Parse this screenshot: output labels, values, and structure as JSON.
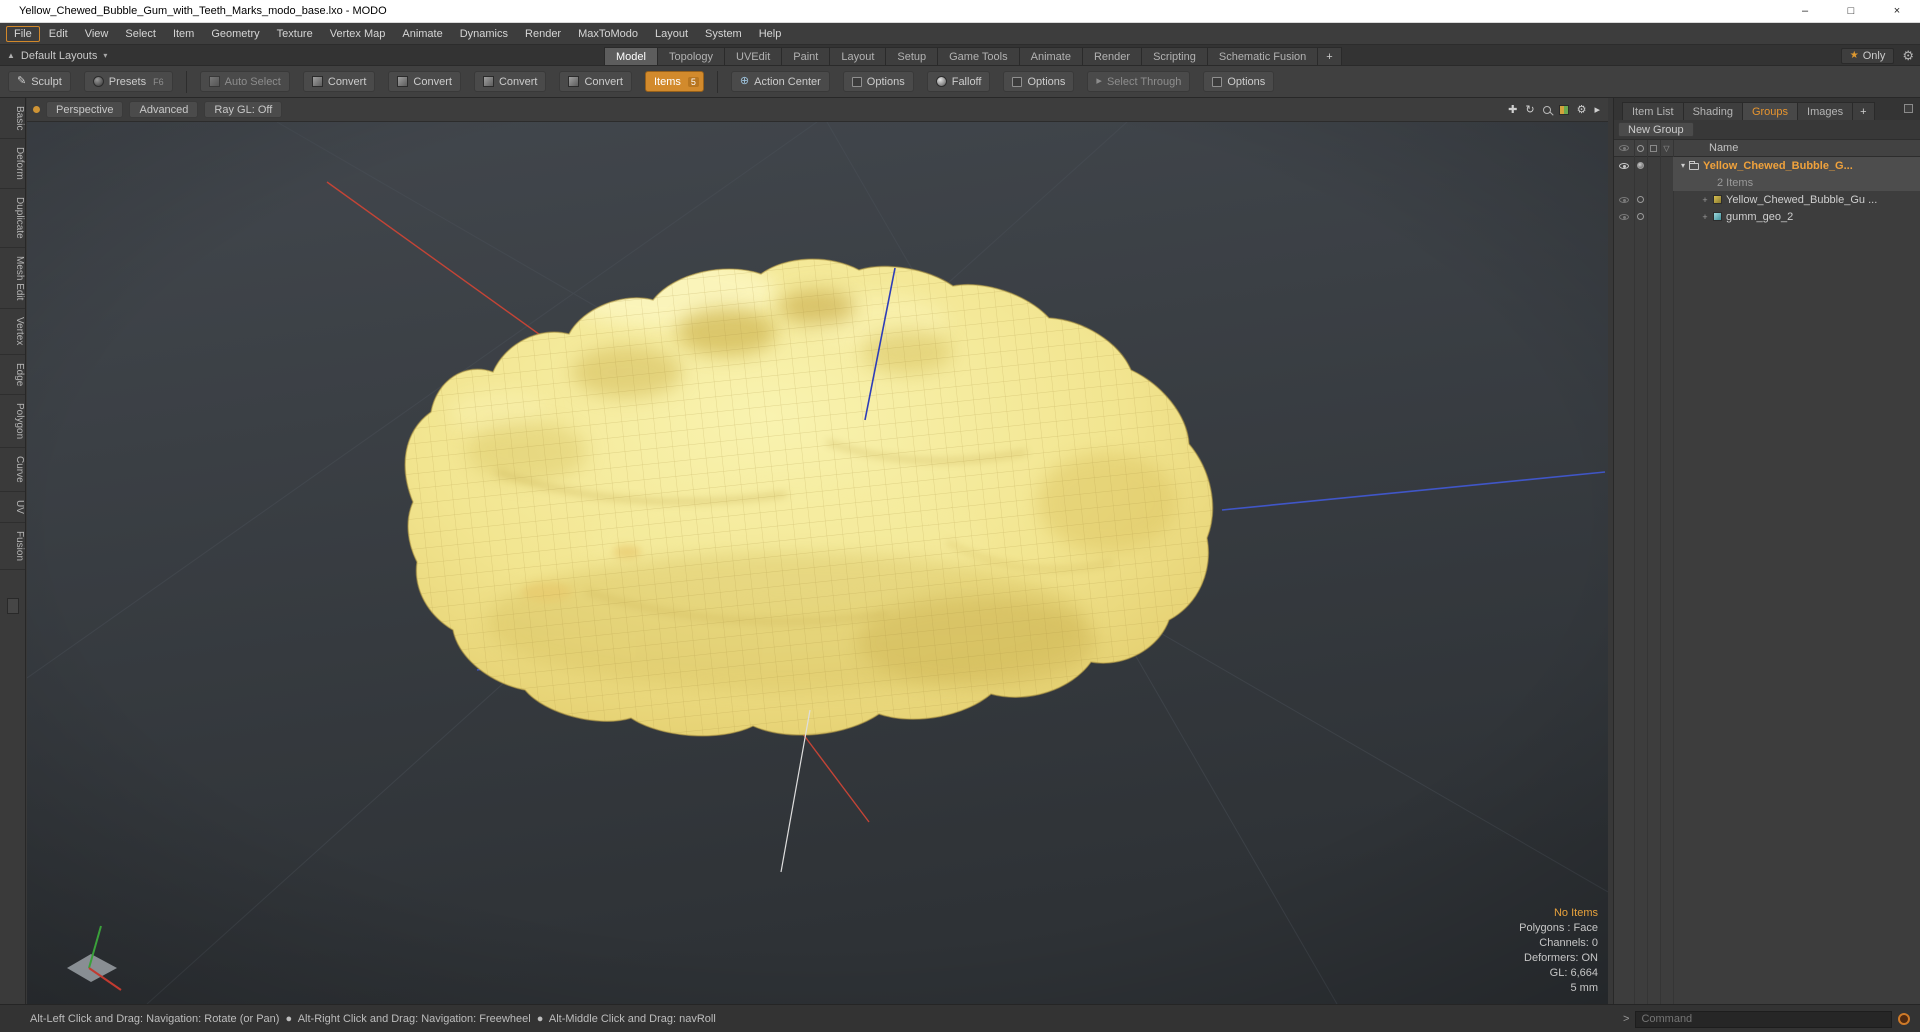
{
  "colors": {
    "accent_orange": "#d28a2c",
    "selected_text_orange": "#f0a23c",
    "viewport_bg_top": "#42474d",
    "viewport_bg_bottom": "#2e3236",
    "gum_light": "#f9f3b0",
    "gum_dark": "#d9c363",
    "axis_red": "#c44436",
    "axis_blue": "#4056c8",
    "axis_white": "#dedede"
  },
  "icons": {
    "star": "★",
    "caret_down": "▾",
    "up_arrow": "▲",
    "gear": "⚙",
    "pan": "✚",
    "orbit": "↻",
    "arrow_right": "▸",
    "plus": "+",
    "pencil": "✎",
    "action_center": "⊕",
    "cursor": "▸",
    "funnel": "▽",
    "disclosure_open": "▾",
    "expander_closed": "+"
  },
  "title_bar": {
    "title": "Yellow_Chewed_Bubble_Gum_with_Teeth_Marks_modo_base.lxo - MODO",
    "minimize": "–",
    "maximize": "□",
    "close": "×"
  },
  "menu": {
    "items": [
      "File",
      "Edit",
      "View",
      "Select",
      "Item",
      "Geometry",
      "Texture",
      "Vertex Map",
      "Animate",
      "Dynamics",
      "Render",
      "MaxToModo",
      "Layout",
      "System",
      "Help"
    ]
  },
  "layout_bar": {
    "layouts_label": "Default Layouts",
    "tabs": [
      "Model",
      "Topology",
      "UVEdit",
      "Paint",
      "Layout",
      "Setup",
      "Game Tools",
      "Animate",
      "Render",
      "Scripting",
      "Schematic Fusion"
    ],
    "active_tab": "Model",
    "add_tab": "+",
    "only_label": "Only"
  },
  "toolbar": {
    "sculpt": "Sculpt",
    "presets": "Presets",
    "presets_key": "F6",
    "auto_select": "Auto Select",
    "convert1": "Convert",
    "convert2": "Convert",
    "convert3": "Convert",
    "convert4": "Convert",
    "items": "Items",
    "items_key": "5",
    "action_center": "Action Center",
    "options1": "Options",
    "falloff": "Falloff",
    "options2": "Options",
    "select_through": "Select Through",
    "options3": "Options"
  },
  "left_tabs": {
    "items": [
      "Basic",
      "Deform",
      "Duplicate",
      "Mesh Edit",
      "Vertex",
      "Edge",
      "Polygon",
      "Curve",
      "UV",
      "Fusion"
    ]
  },
  "viewport": {
    "tabs": {
      "perspective": "Perspective",
      "advanced": "Advanced",
      "raygl": "Ray GL: Off"
    },
    "stats": {
      "no_items": "No Items",
      "polygons": "Polygons : Face",
      "channels": "Channels: 0",
      "deformers": "Deformers: ON",
      "gl": "GL: 6,664",
      "scale": "5 mm"
    }
  },
  "right_panel": {
    "tabs": [
      "Item List",
      "Shading",
      "Groups",
      "Images"
    ],
    "active_tab": "Groups",
    "add_tab": "+",
    "new_group": "New Group",
    "name_header": "Name",
    "rows": [
      {
        "label": "Yellow_Chewed_Bubble_G...",
        "sub": "2 Items"
      },
      {
        "label": "Yellow_Chewed_Bubble_Gu ..."
      },
      {
        "label": "gumm_geo_2"
      }
    ]
  },
  "status_bar": {
    "hints": "Alt-Left Click and Drag: Navigation: Rotate (or Pan)  ●  Alt-Right Click and Drag: Navigation: Freewheel  ●  Alt-Middle Click and Drag: navRoll",
    "command_prompt": ">",
    "command_placeholder": "Command"
  }
}
